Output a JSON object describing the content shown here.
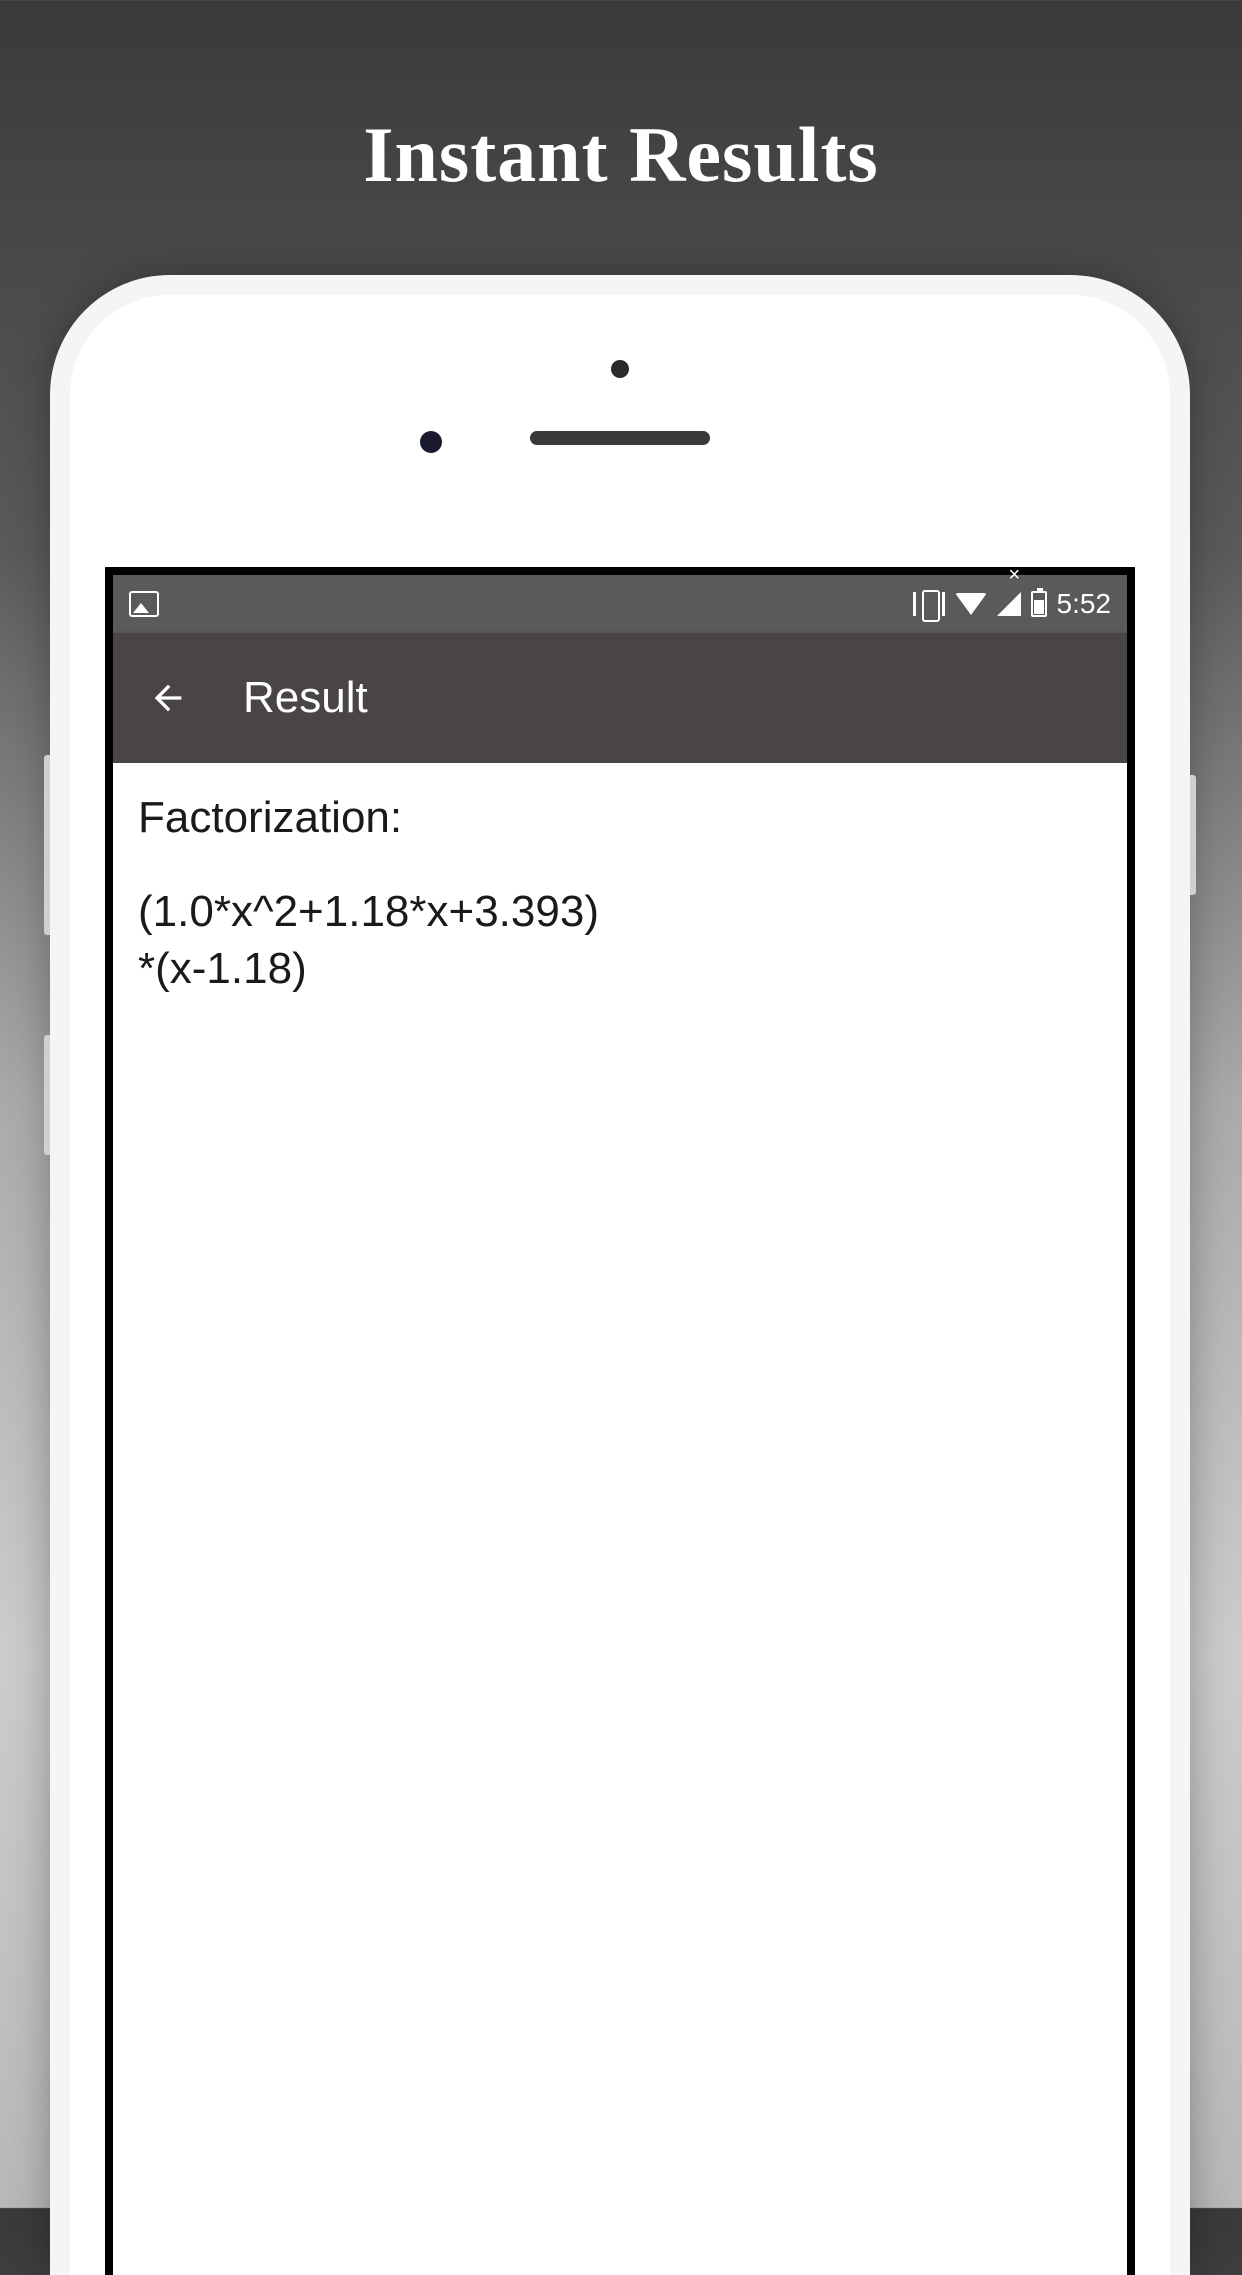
{
  "promo": {
    "title": "Instant Results"
  },
  "status_bar": {
    "time": "5:52"
  },
  "app_bar": {
    "title": "Result"
  },
  "content": {
    "label": "Factorization:",
    "line1": "(1.0*x^2+1.18*x+3.393)",
    "line2": "*(x-1.18)"
  }
}
